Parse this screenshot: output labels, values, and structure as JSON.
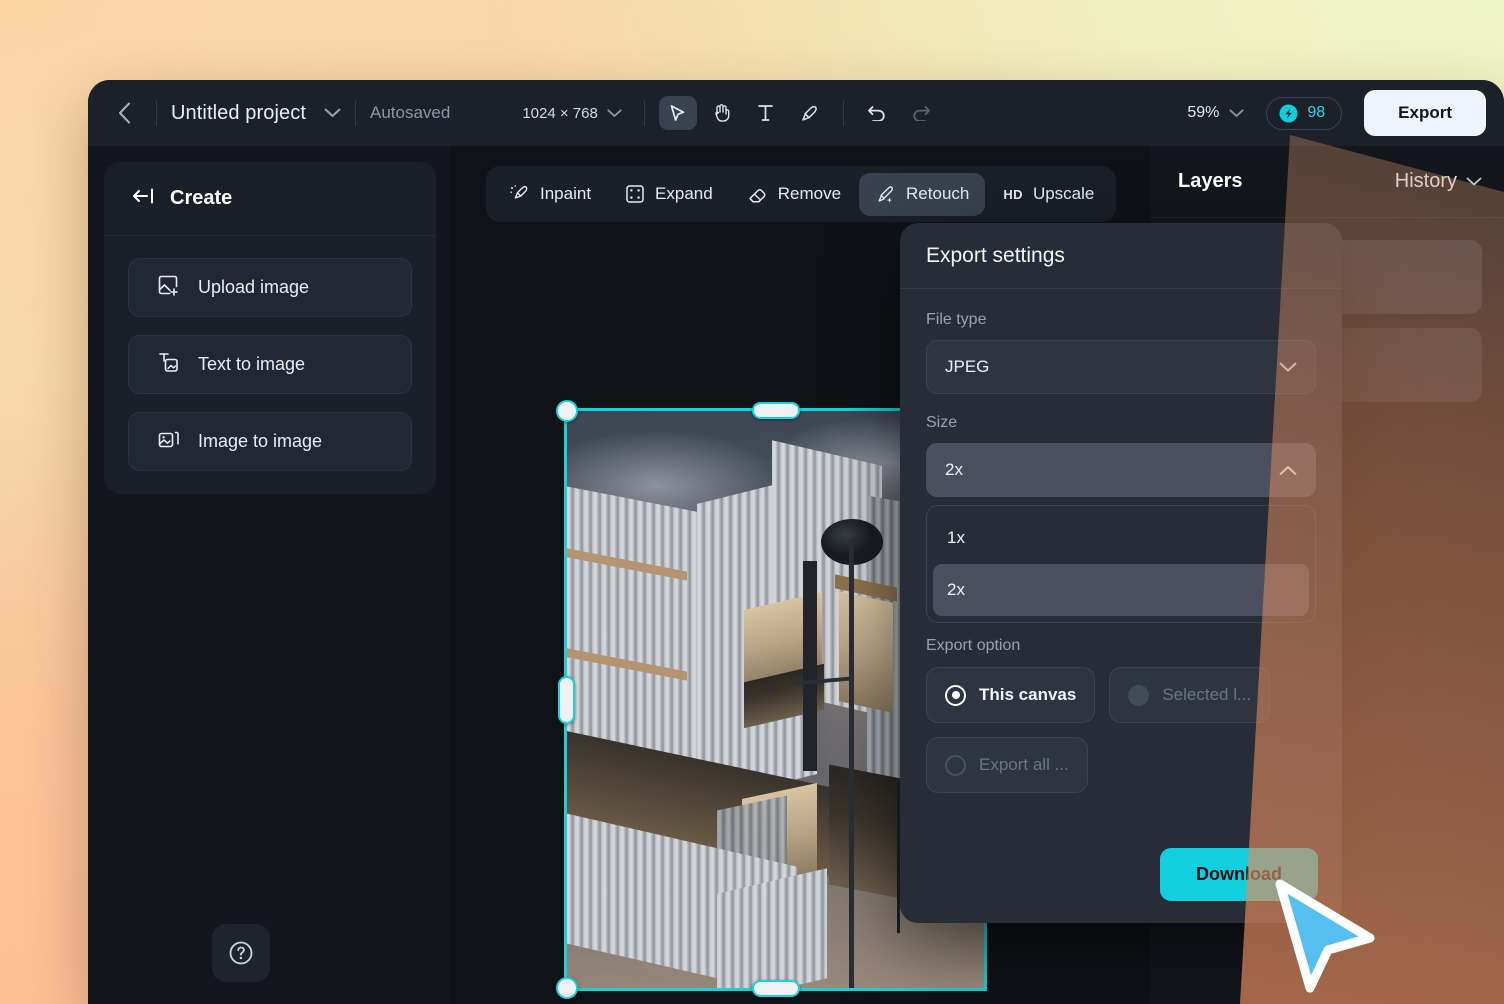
{
  "header": {
    "back_icon": "chevron-left-icon",
    "project_title": "Untitled project",
    "project_chevron": "chevron-down-icon",
    "autosaved": "Autosaved",
    "canvas_dimensions": "1024 × 768",
    "dimensions_chevron": "chevron-down-icon",
    "tools": [
      {
        "name": "select-tool",
        "icon": "cursor-arrow-icon",
        "active": true
      },
      {
        "name": "hand-tool",
        "icon": "hand-icon",
        "active": false
      },
      {
        "name": "text-tool",
        "icon": "text-t-icon",
        "active": false
      },
      {
        "name": "brush-tool",
        "icon": "brush-icon",
        "active": false
      },
      {
        "name": "undo",
        "icon": "undo-arrow-icon",
        "active": false
      },
      {
        "name": "redo",
        "icon": "redo-arrow-icon",
        "active": false
      }
    ],
    "zoom_level": "59%",
    "zoom_chevron": "chevron-down-icon",
    "credits_icon": "credit-token-icon",
    "credits_count": "98",
    "export_label": "Export"
  },
  "sidebar": {
    "collapse_icon": "collapse-left-icon",
    "title": "Create",
    "items": [
      {
        "label": "Upload image",
        "icon": "image-plus-icon"
      },
      {
        "label": "Text to image",
        "icon": "text-to-image-icon"
      },
      {
        "label": "Image to image",
        "icon": "image-stack-icon"
      }
    ],
    "help_icon": "question-circle-icon"
  },
  "edit_toolbar": {
    "items": [
      {
        "label": "Inpaint",
        "icon": "magic-brush-icon",
        "active": false
      },
      {
        "label": "Expand",
        "icon": "expand-frame-icon",
        "active": false
      },
      {
        "label": "Remove",
        "icon": "eraser-icon",
        "active": false
      },
      {
        "label": "Retouch",
        "icon": "sparkle-wand-icon",
        "active": true
      },
      {
        "label": "Upscale",
        "icon": "hd-badge-icon",
        "badge": "HD",
        "active": false
      }
    ]
  },
  "right_panel": {
    "layers_tab": "Layers",
    "history_tab": "History",
    "history_chevron": "chevron-down-icon"
  },
  "dialog": {
    "title": "Export settings",
    "file_type_label": "File type",
    "file_type_value": "JPEG",
    "file_type_chevron": "chevron-down-icon",
    "size_label": "Size",
    "size_value": "2x",
    "size_chevron": "chevron-up-icon",
    "size_options": [
      {
        "label": "1x",
        "selected": false
      },
      {
        "label": "2x",
        "selected": true
      }
    ],
    "export_option_label": "Export option",
    "export_options": [
      {
        "label": "This canvas",
        "selected": true,
        "enabled": true
      },
      {
        "label": "Selected l...",
        "selected": false,
        "enabled": false
      },
      {
        "label": "Export all ...",
        "selected": false,
        "enabled": false
      }
    ],
    "download_label": "Download"
  },
  "canvas": {
    "selection_handles": [
      "top-left",
      "top-center",
      "left-middle",
      "bottom-left",
      "bottom-center"
    ],
    "selection_color": "#17d2d8"
  },
  "cursor": {
    "icon": "pointer-arrow-cursor",
    "color": "#55c0f0"
  }
}
